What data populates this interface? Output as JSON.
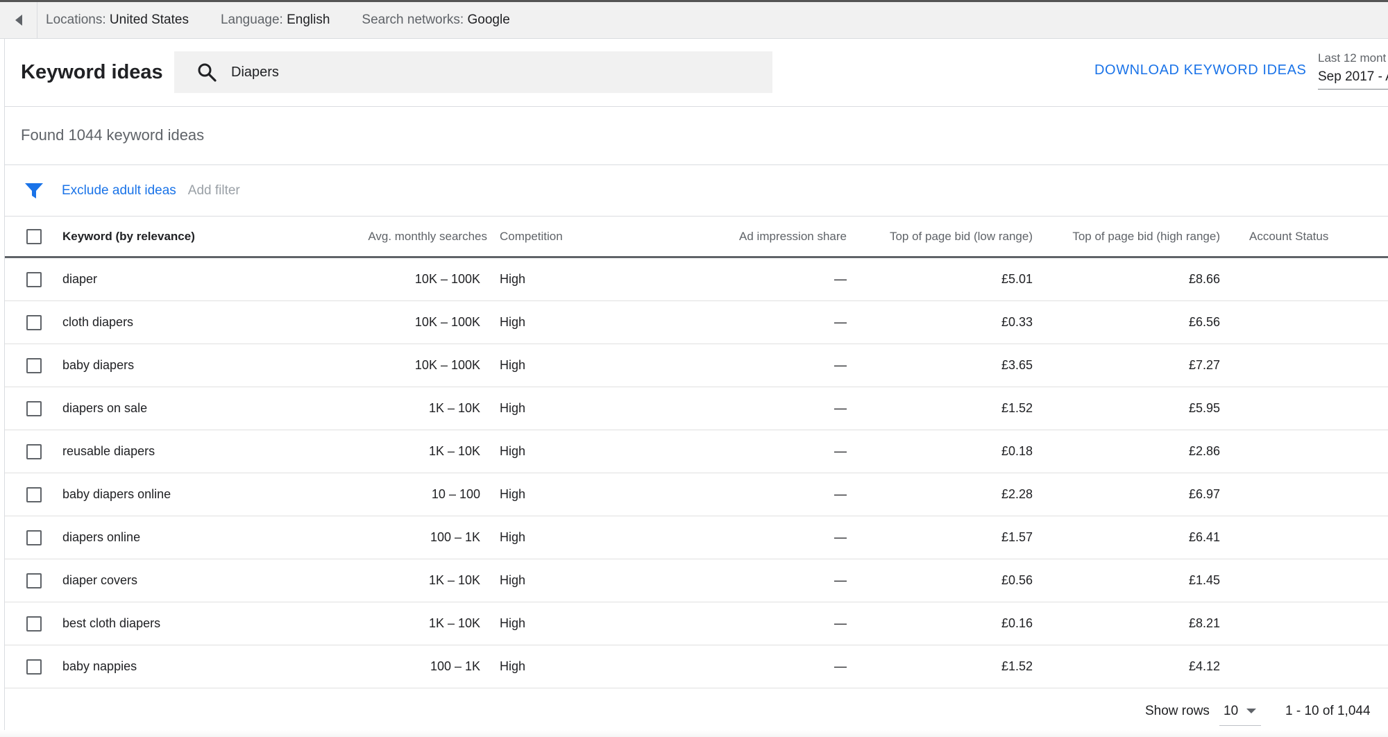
{
  "topbar": {
    "locations_label": "Locations:",
    "locations_value": "United States",
    "language_label": "Language:",
    "language_value": "English",
    "networks_label": "Search networks:",
    "networks_value": "Google"
  },
  "header": {
    "title": "Keyword ideas",
    "search_value": "Diapers",
    "download_label": "DOWNLOAD KEYWORD IDEAS",
    "range_label": "Last 12 mont",
    "range_value": "Sep 2017 - A"
  },
  "found_text": "Found 1044 keyword ideas",
  "filters": {
    "exclude_adult": "Exclude adult ideas",
    "add_filter": "Add filter"
  },
  "table": {
    "columns": {
      "keyword": "Keyword (by relevance)",
      "searches": "Avg. monthly searches",
      "competition": "Competition",
      "impression": "Ad impression share",
      "bid_low": "Top of page bid (low range)",
      "bid_high": "Top of page bid (high range)",
      "status": "Account Status"
    },
    "rows": [
      {
        "keyword": "diaper",
        "searches": "10K – 100K",
        "competition": "High",
        "impression": "—",
        "bid_low": "£5.01",
        "bid_high": "£8.66"
      },
      {
        "keyword": "cloth diapers",
        "searches": "10K – 100K",
        "competition": "High",
        "impression": "—",
        "bid_low": "£0.33",
        "bid_high": "£6.56"
      },
      {
        "keyword": "baby diapers",
        "searches": "10K – 100K",
        "competition": "High",
        "impression": "—",
        "bid_low": "£3.65",
        "bid_high": "£7.27"
      },
      {
        "keyword": "diapers on sale",
        "searches": "1K – 10K",
        "competition": "High",
        "impression": "—",
        "bid_low": "£1.52",
        "bid_high": "£5.95"
      },
      {
        "keyword": "reusable diapers",
        "searches": "1K – 10K",
        "competition": "High",
        "impression": "—",
        "bid_low": "£0.18",
        "bid_high": "£2.86"
      },
      {
        "keyword": "baby diapers online",
        "searches": "10 – 100",
        "competition": "High",
        "impression": "—",
        "bid_low": "£2.28",
        "bid_high": "£6.97"
      },
      {
        "keyword": "diapers online",
        "searches": "100 – 1K",
        "competition": "High",
        "impression": "—",
        "bid_low": "£1.57",
        "bid_high": "£6.41"
      },
      {
        "keyword": "diaper covers",
        "searches": "1K – 10K",
        "competition": "High",
        "impression": "—",
        "bid_low": "£0.56",
        "bid_high": "£1.45"
      },
      {
        "keyword": "best cloth diapers",
        "searches": "1K – 10K",
        "competition": "High",
        "impression": "—",
        "bid_low": "£0.16",
        "bid_high": "£8.21"
      },
      {
        "keyword": "baby nappies",
        "searches": "100 – 1K",
        "competition": "High",
        "impression": "—",
        "bid_low": "£1.52",
        "bid_high": "£4.12"
      }
    ]
  },
  "footer": {
    "show_rows_label": "Show rows",
    "show_rows_value": "10",
    "pager_text": "1 - 10 of 1,044"
  },
  "icons": {
    "back": "triangle-left-icon",
    "search": "magnifier-icon",
    "filter": "funnel-icon",
    "dropdown": "caret-down-icon"
  },
  "colors": {
    "accent": "#1a73e8",
    "muted": "#5f6368",
    "surface": "#f1f1f1"
  }
}
